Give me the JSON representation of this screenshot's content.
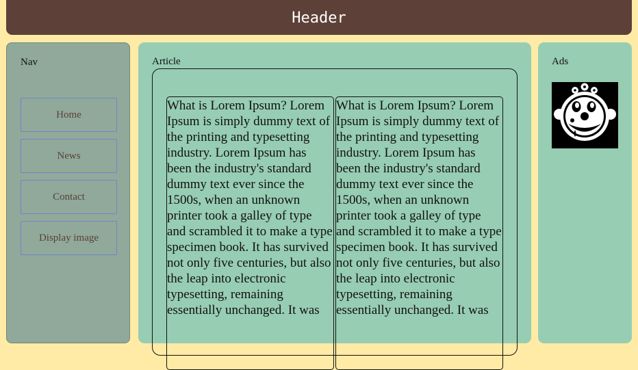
{
  "header": {
    "title": "Header"
  },
  "nav": {
    "heading": "Nav",
    "items": [
      {
        "label": "Home"
      },
      {
        "label": "News"
      },
      {
        "label": "Contact"
      },
      {
        "label": "Display image"
      }
    ]
  },
  "article": {
    "heading": "Article",
    "columns": [
      {
        "text": "What is Lorem Ipsum? Lorem Ipsum is simply dummy text of the printing and typesetting industry. Lorem Ipsum has been the industry's standard dummy text ever since the 1500s, when an unknown printer took a galley of type and scrambled it to make a type specimen book. It has survived not only five centuries, but also the leap into electronic typesetting, remaining essentially unchanged. It was"
      },
      {
        "text": "What is Lorem Ipsum? Lorem Ipsum is simply dummy text of the printing and typesetting industry. Lorem Ipsum has been the industry's standard dummy text ever since the 1500s, when an unknown printer took a galley of type and scrambled it to make a type specimen book. It has survived not only five centuries, but also the leap into electronic typesetting, remaining essentially unchanged. It was"
      }
    ]
  },
  "ads": {
    "heading": "Ads",
    "image_icon": "smiling-clown-face-icon"
  },
  "colors": {
    "background": "#ffeba5",
    "header": "#5d4037",
    "nav": "#90a99a",
    "panel": "#97cdb3",
    "nav_button_border": "#6e87c8"
  }
}
